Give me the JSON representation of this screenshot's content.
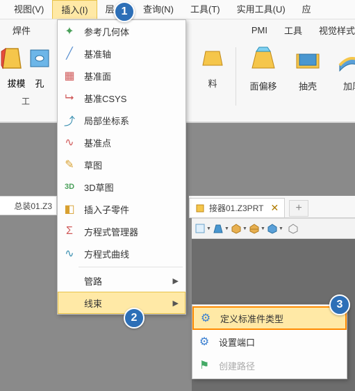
{
  "menu": {
    "items": [
      "视图(V)",
      "插入(I)",
      "层(A)",
      "查询(N)",
      "工具(T)",
      "实用工具(U)",
      "应"
    ],
    "active_index": 1
  },
  "ribbon": {
    "tabs_left": "焊件",
    "tabs_right": [
      "PMI",
      "工具",
      "视觉样式"
    ],
    "left_labels": [
      "拔模",
      "孔"
    ],
    "left_small": "工",
    "mid_cut_label": "料",
    "btns": {
      "offset": "面偏移",
      "shell": "抽壳",
      "thicken": "加厚"
    }
  },
  "dropdown": [
    {
      "icon": "✦",
      "label": "参考几何体"
    },
    {
      "icon": "╱",
      "label": "基准轴"
    },
    {
      "icon": "▦",
      "label": "基准面"
    },
    {
      "icon": "⮡",
      "label": "基准CSYS"
    },
    {
      "icon": "⤴",
      "label": "局部坐标系"
    },
    {
      "icon": "∿",
      "label": "基准点"
    },
    {
      "icon": "✎",
      "label": "草图"
    },
    {
      "icon": "3D",
      "label": "3D草图"
    },
    {
      "icon": "◧",
      "label": "插入子零件"
    },
    {
      "icon": "Σ",
      "label": "方程式管理器"
    },
    {
      "icon": "∿",
      "label": "方程式曲线"
    }
  ],
  "dropdown_tail": [
    {
      "label": "管路",
      "arrow": true
    },
    {
      "label": "线束",
      "arrow": true,
      "hl": true
    }
  ],
  "submenu": [
    {
      "icon": "⚙",
      "label": "定义标准件类型",
      "hl": true
    },
    {
      "icon": "⚙",
      "label": "设置端口"
    },
    {
      "icon": "⚑",
      "label": "创建路径",
      "disabled": true
    }
  ],
  "doctabs": {
    "left": "总装01.Z3",
    "right": "接器01.Z3PRT",
    "plus": "+"
  },
  "badges": {
    "b1": "1",
    "b2": "2",
    "b3": "3"
  }
}
